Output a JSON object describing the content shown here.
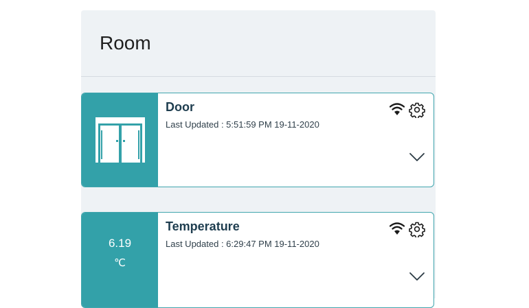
{
  "panel": {
    "title": "Room"
  },
  "cards": [
    {
      "title": "Door",
      "last_updated": "Last Updated : 5:51:59 PM 19-11-2020",
      "icon": "door-icon"
    },
    {
      "title": "Temperature",
      "last_updated": "Last Updated : 6:29:47 PM 19-11-2020",
      "value": "6.19",
      "unit": "℃"
    }
  ],
  "colors": {
    "accent": "#33a1a9",
    "panel_bg": "#eef2f5",
    "title_text": "#1e3d4f"
  }
}
